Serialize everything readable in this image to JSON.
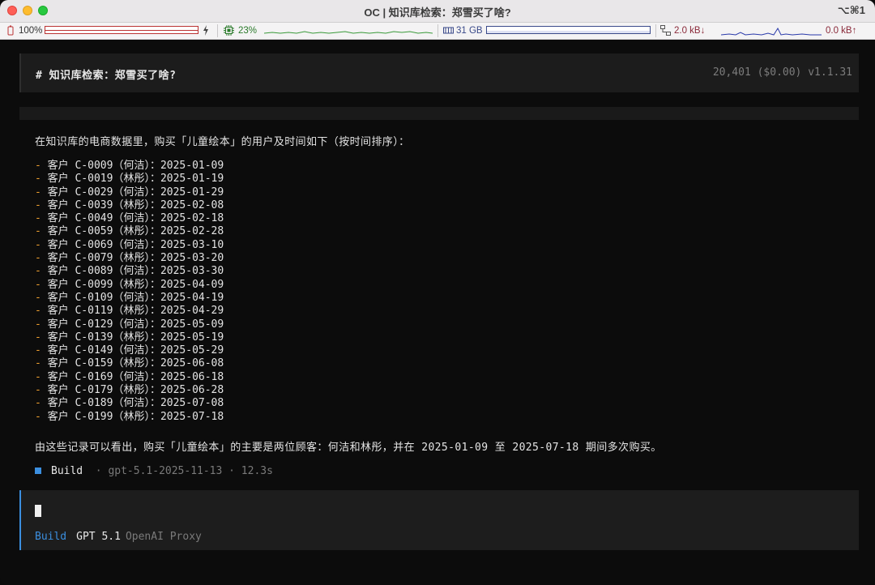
{
  "window": {
    "title": "OC | 知识库检索：郑雪买了啥?",
    "shortcut": "⌥⌘1"
  },
  "statusbar": {
    "battery": "100%",
    "cpu": "23%",
    "memory": "31 GB",
    "net_down": "2.0 kB↓",
    "net_up": "0.0 kB↑"
  },
  "header": {
    "title": "# 知识库检索：郑雪买了啥?",
    "meta": "20,401 ($0.00) v1.1.31"
  },
  "message": {
    "intro": "在知识库的电商数据里，购买「儿童绘本」的用户及时间如下（按时间排序）：",
    "dash": "-",
    "items": [
      "客户 C-0009（何洁）：2025-01-09",
      "客户 C-0019（林彤）：2025-01-19",
      "客户 C-0029（何洁）：2025-01-29",
      "客户 C-0039（林彤）：2025-02-08",
      "客户 C-0049（何洁）：2025-02-18",
      "客户 C-0059（林彤）：2025-02-28",
      "客户 C-0069（何洁）：2025-03-10",
      "客户 C-0079（林彤）：2025-03-20",
      "客户 C-0089（何洁）：2025-03-30",
      "客户 C-0099（林彤）：2025-04-09",
      "客户 C-0109（何洁）：2025-04-19",
      "客户 C-0119（林彤）：2025-04-29",
      "客户 C-0129（何洁）：2025-05-09",
      "客户 C-0139（林彤）：2025-05-19",
      "客户 C-0149（何洁）：2025-05-29",
      "客户 C-0159（林彤）：2025-06-08",
      "客户 C-0169（何洁）：2025-06-18",
      "客户 C-0179（林彤）：2025-06-28",
      "客户 C-0189（何洁）：2025-07-08",
      "客户 C-0199（林彤）：2025-07-18"
    ],
    "summary": "由这些记录可以看出，购买「儿童绘本」的主要是两位顾客：何洁和林彤，并在 2025-01-09 至 2025-07-18 期间多次购买。"
  },
  "build": {
    "name": "Build",
    "meta": "· gpt-5.1-2025-11-13 · 12.3s"
  },
  "footer": {
    "mode": "Build",
    "model": "GPT 5.1",
    "provider": "OpenAI Proxy"
  },
  "colors": {
    "accent": "#3b8fe0",
    "dash": "#f0a030"
  },
  "icons": {
    "battery": "battery-icon",
    "charging": "bolt-icon",
    "cpu": "cpu-icon",
    "memory": "memory-icon",
    "network": "network-icon"
  }
}
